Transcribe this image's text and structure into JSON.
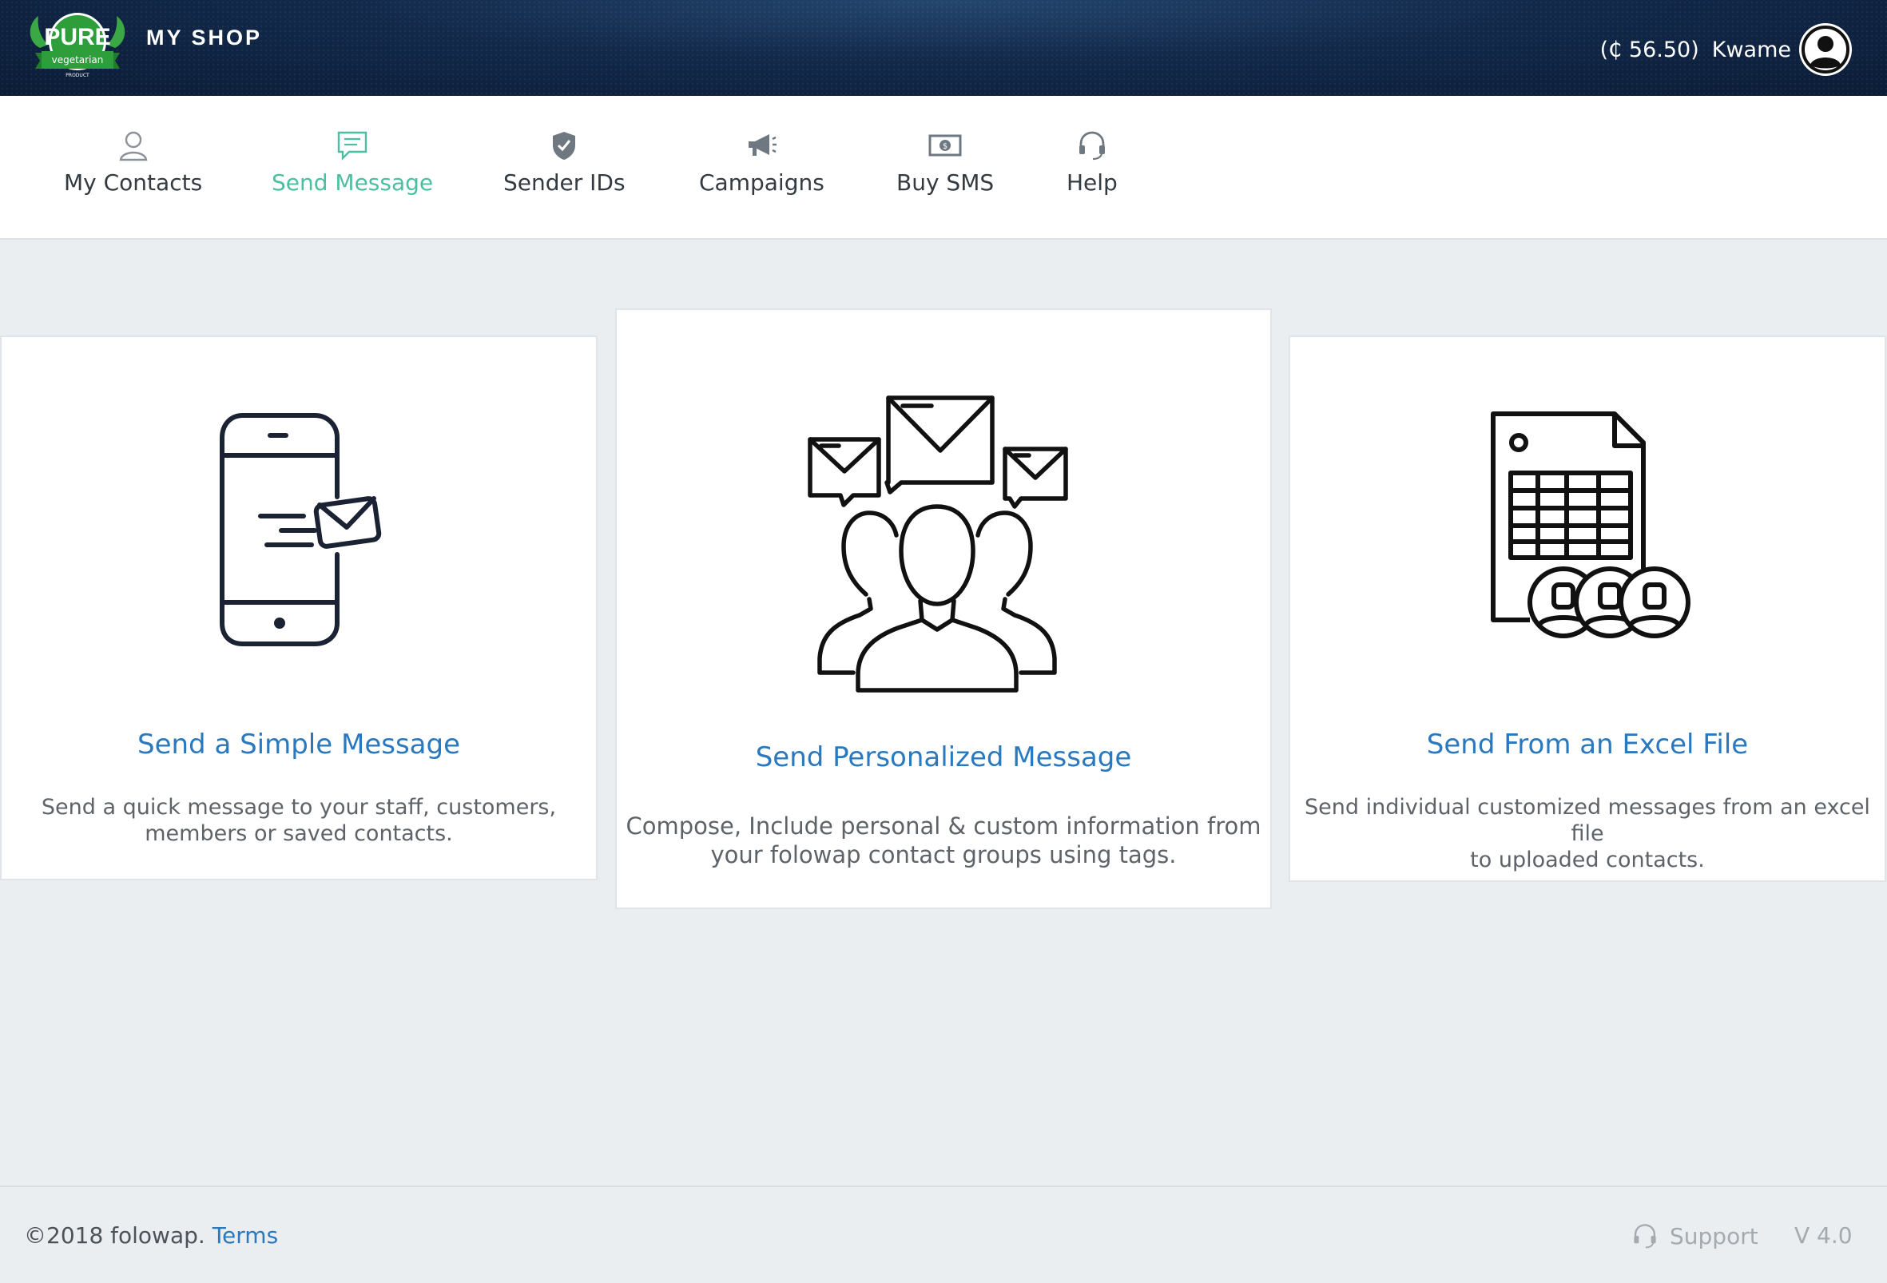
{
  "header": {
    "logo_text": "PURE",
    "logo_ribbon": "vegetarian",
    "logo_sub": "PRODUCT",
    "shop_name": "MY SHOP",
    "balance": "(₵ 56.50)",
    "username": "Kwame"
  },
  "nav": {
    "items": [
      {
        "label": "My Contacts",
        "icon": "user-outline-icon"
      },
      {
        "label": "Send Message",
        "icon": "chat-bubble-icon"
      },
      {
        "label": "Sender IDs",
        "icon": "shield-check-icon"
      },
      {
        "label": "Campaigns",
        "icon": "megaphone-icon"
      },
      {
        "label": "Buy SMS",
        "icon": "money-bill-icon"
      },
      {
        "label": "Help",
        "icon": "headset-icon"
      }
    ],
    "active": "Send Message"
  },
  "cards": [
    {
      "title": "Send a Simple Message",
      "desc_line1": "Send a quick message to your staff, customers,",
      "desc_line2": "members or saved contacts.",
      "icon": "phone-message-icon"
    },
    {
      "title": "Send Personalized Message",
      "desc_line1": "Compose, Include personal & custom information from",
      "desc_line2": "your folowap contact groups using tags.",
      "icon": "group-messages-icon"
    },
    {
      "title": "Send From an Excel File",
      "desc_line1": "Send individual customized messages from an excel file",
      "desc_line2": "to uploaded contacts.",
      "icon": "spreadsheet-contacts-icon"
    }
  ],
  "footer": {
    "copyright": "©2018 folowap.",
    "terms": "Terms",
    "support": "Support",
    "version": "V 4.0"
  },
  "colors": {
    "accent_active": "#4bbfa1",
    "link_blue": "#2a78bd",
    "header_bg": "#12294a",
    "logo_green": "#2e9e3a"
  }
}
